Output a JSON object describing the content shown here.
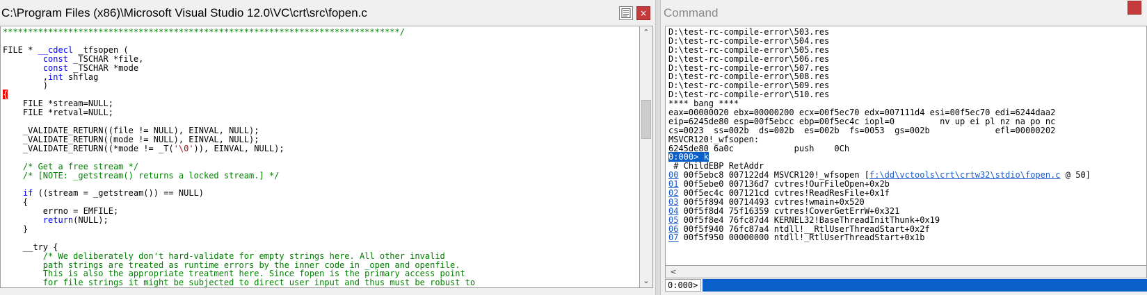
{
  "editor": {
    "title": "C:\\Program Files (x86)\\Microsoft Visual Studio 12.0\\VC\\crt\\src\\fopen.c",
    "doc_icon": "document-icon",
    "close_icon": "close-icon",
    "close_glyph": "×",
    "scroll_up_glyph": "⌃",
    "scroll_down_glyph": "⌄",
    "lines": [
      [
        {
          "c": "cm",
          "t": "*******************************************************************************/"
        }
      ],
      [
        {
          "c": "",
          "t": ""
        }
      ],
      [
        {
          "c": "",
          "t": "FILE * "
        },
        {
          "c": "kw",
          "t": "__cdecl"
        },
        {
          "c": "",
          "t": " _tfsopen ("
        }
      ],
      [
        {
          "c": "",
          "t": "        "
        },
        {
          "c": "kw",
          "t": "const"
        },
        {
          "c": "",
          "t": " _TSCHAR *file,"
        }
      ],
      [
        {
          "c": "",
          "t": "        "
        },
        {
          "c": "kw",
          "t": "const"
        },
        {
          "c": "",
          "t": " _TSCHAR *mode"
        }
      ],
      [
        {
          "c": "",
          "t": "        ,"
        },
        {
          "c": "kw",
          "t": "int"
        },
        {
          "c": "",
          "t": " shflag"
        }
      ],
      [
        {
          "c": "",
          "t": "        )"
        }
      ],
      [
        {
          "c": "brace",
          "t": "{"
        }
      ],
      [
        {
          "c": "",
          "t": "    FILE *stream=NULL;"
        }
      ],
      [
        {
          "c": "",
          "t": "    FILE *retval=NULL;"
        }
      ],
      [
        {
          "c": "",
          "t": ""
        }
      ],
      [
        {
          "c": "",
          "t": "    _VALIDATE_RETURN((file != NULL), EINVAL, NULL);"
        }
      ],
      [
        {
          "c": "",
          "t": "    _VALIDATE_RETURN((mode != NULL), EINVAL, NULL);"
        }
      ],
      [
        {
          "c": "",
          "t": "    _VALIDATE_RETURN((*mode != _T("
        },
        {
          "c": "st",
          "t": "'\\0'"
        },
        {
          "c": "",
          "t": ")), EINVAL, NULL);"
        }
      ],
      [
        {
          "c": "",
          "t": ""
        }
      ],
      [
        {
          "c": "cm",
          "t": "    /* Get a free stream */"
        }
      ],
      [
        {
          "c": "cm",
          "t": "    /* [NOTE: _getstream() returns a locked stream.] */"
        }
      ],
      [
        {
          "c": "",
          "t": ""
        }
      ],
      [
        {
          "c": "",
          "t": "    "
        },
        {
          "c": "kw",
          "t": "if"
        },
        {
          "c": "",
          "t": " ((stream = _getstream()) == NULL)"
        }
      ],
      [
        {
          "c": "",
          "t": "    {"
        }
      ],
      [
        {
          "c": "",
          "t": "        errno = EMFILE;"
        }
      ],
      [
        {
          "c": "",
          "t": "        "
        },
        {
          "c": "kw",
          "t": "return"
        },
        {
          "c": "",
          "t": "(NULL);"
        }
      ],
      [
        {
          "c": "",
          "t": "    }"
        }
      ],
      [
        {
          "c": "",
          "t": ""
        }
      ],
      [
        {
          "c": "",
          "t": "    __try {"
        }
      ],
      [
        {
          "c": "cm",
          "t": "        /* We deliberately don't hard-validate for empty strings here. All other invalid"
        }
      ],
      [
        {
          "c": "cm",
          "t": "        path strings are treated as runtime errors by the inner code in _open and openfile."
        }
      ],
      [
        {
          "c": "cm",
          "t": "        This is also the appropriate treatment here. Since fopen is the primary access point"
        }
      ],
      [
        {
          "c": "cm",
          "t": "        for file strings it might be subjected to direct user input and thus must be robust to"
        }
      ]
    ]
  },
  "command": {
    "title": "Command",
    "scroll_left_glyph": "<",
    "prompt_label": "0:000>",
    "lines": [
      "D:\\test-rc-compile-error\\503.res",
      "D:\\test-rc-compile-error\\504.res",
      "D:\\test-rc-compile-error\\505.res",
      "D:\\test-rc-compile-error\\506.res",
      "D:\\test-rc-compile-error\\507.res",
      "D:\\test-rc-compile-error\\508.res",
      "D:\\test-rc-compile-error\\509.res",
      "D:\\test-rc-compile-error\\510.res",
      "**** bang ****",
      "eax=00000020 ebx=00000200 ecx=00f5ec70 edx=007111d4 esi=00f5ec70 edi=6244daa2",
      "eip=6245de80 esp=00f5ebcc ebp=00f5ec4c iopl=0         nv up ei pl nz na po nc",
      "cs=0023  ss=002b  ds=002b  es=002b  fs=0053  gs=002b             efl=00000202",
      "MSVCR120!_wfsopen:",
      "6245de80 6a0c            push    0Ch"
    ],
    "prompt_line": {
      "prompt": "0:000>",
      "cmd": " k"
    },
    "stack_header": " # ChildEBP RetAddr",
    "frames": [
      {
        "num": "00",
        "rest": " 00f5ebc8 007122d4 MSVCR120!_wfsopen [",
        "link": "f:\\dd\\vctools\\crt\\crtw32\\stdio\\fopen.c",
        "tail": " @ 50]"
      },
      {
        "num": "01",
        "rest": " 00f5ebe0 007136d7 cvtres!OurFileOpen+0x2b",
        "link": "",
        "tail": ""
      },
      {
        "num": "02",
        "rest": " 00f5ec4c 007121cd cvtres!ReadResFile+0x1f",
        "link": "",
        "tail": ""
      },
      {
        "num": "03",
        "rest": " 00f5f894 00714493 cvtres!wmain+0x520",
        "link": "",
        "tail": ""
      },
      {
        "num": "04",
        "rest": " 00f5f8d4 75f16359 cvtres!CoverGetErrW+0x321",
        "link": "",
        "tail": ""
      },
      {
        "num": "05",
        "rest": " 00f5f8e4 76fc87d4 KERNEL32!BaseThreadInitThunk+0x19",
        "link": "",
        "tail": ""
      },
      {
        "num": "06",
        "rest": " 00f5f940 76fc87a4 ntdll!__RtlUserThreadStart+0x2f",
        "link": "",
        "tail": ""
      },
      {
        "num": "07",
        "rest": " 00f5f950 00000000 ntdll!_RtlUserThreadStart+0x1b",
        "link": "",
        "tail": ""
      }
    ]
  }
}
